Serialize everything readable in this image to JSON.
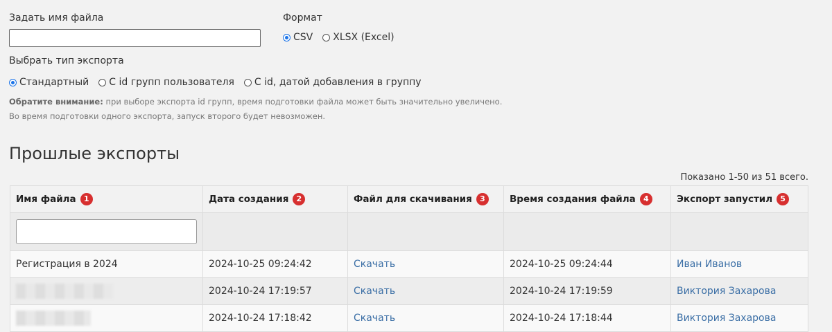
{
  "form": {
    "file_name_label": "Задать имя файла",
    "file_name_value": "",
    "format_label": "Формат",
    "format_options": [
      {
        "label": "CSV",
        "checked": true
      },
      {
        "label": "XLSX (Excel)",
        "checked": false
      }
    ],
    "export_type_label": "Выбрать тип экспорта",
    "export_type_options": [
      {
        "label": "Стандартный",
        "checked": true
      },
      {
        "label": "С id групп пользователя",
        "checked": false
      },
      {
        "label": "С id, датой добавления в группу",
        "checked": false
      }
    ],
    "note_bold": "Обратите внимание:",
    "note_text": " при выборе экспорта id групп, время подготовки файла может быть значительно увеличено.",
    "note_line2": "Во время подготовки одного экспорта, запуск второго будет невозможен."
  },
  "past_exports": {
    "title": "Прошлые экспорты",
    "summary": "Показано 1-50 из 51 всего.",
    "columns": [
      {
        "label": "Имя файла",
        "badge": "1"
      },
      {
        "label": "Дата создания",
        "badge": "2"
      },
      {
        "label": "Файл для скачивания",
        "badge": "3"
      },
      {
        "label": "Время создания файла",
        "badge": "4"
      },
      {
        "label": "Экспорт запустил",
        "badge": "5"
      }
    ],
    "filter_value": "",
    "rows": [
      {
        "file_name": "Регистрация в 2024",
        "created": "2024-10-25 09:24:42",
        "download": "Скачать",
        "file_time": "2024-10-25 09:24:44",
        "user": "Иван Иванов"
      },
      {
        "file_name": "",
        "created": "2024-10-24 17:19:57",
        "download": "Скачать",
        "file_time": "2024-10-24 17:19:59",
        "user": "Виктория Захарова"
      },
      {
        "file_name": "",
        "created": "2024-10-24 17:18:42",
        "download": "Скачать",
        "file_time": "2024-10-24 17:18:44",
        "user": "Виктория Захарова"
      }
    ]
  },
  "colors": {
    "accent": "#1a73e8",
    "link": "#3a6ea5",
    "badge": "#d72f2f"
  }
}
